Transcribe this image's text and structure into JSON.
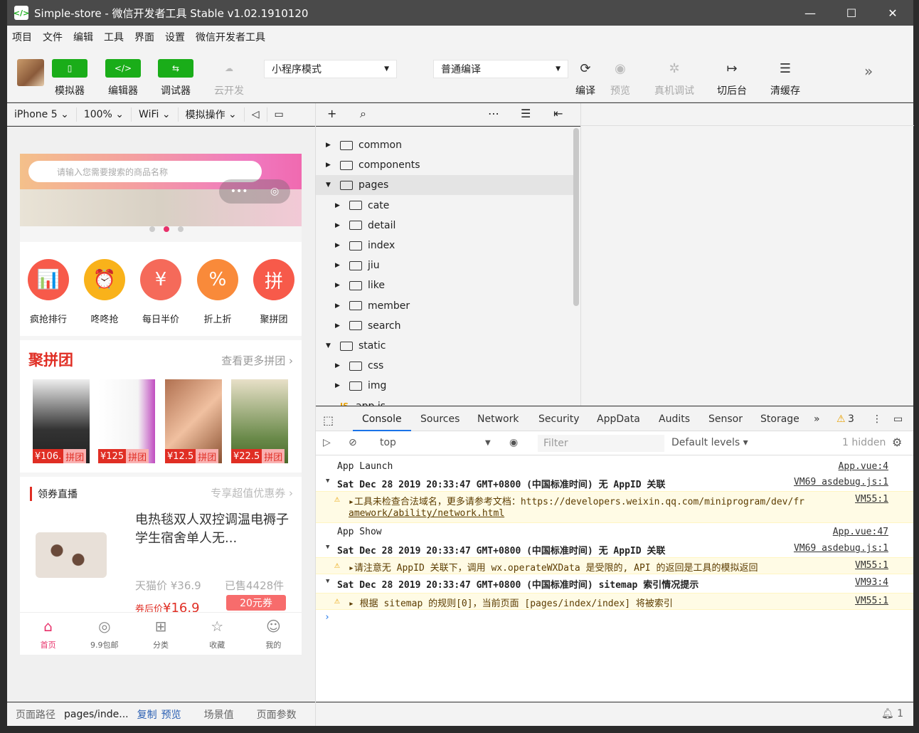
{
  "window": {
    "title": "Simple-store - 微信开发者工具 Stable v1.02.1910120",
    "controls": [
      "—",
      "☐",
      "✕"
    ]
  },
  "menu": [
    "项目",
    "文件",
    "编辑",
    "工具",
    "界面",
    "设置",
    "微信开发者工具"
  ],
  "toolbar": {
    "simulator": "模拟器",
    "editor": "编辑器",
    "debugger": "调试器",
    "cloud": "云开发",
    "mode": "小程序模式",
    "compile_mode": "普通编译",
    "compile": "编译",
    "preview": "预览",
    "remote_debug": "真机调试",
    "background": "切后台",
    "clear_cache": "清缓存"
  },
  "simbar": {
    "device": "iPhone 5",
    "zoom": "100%",
    "network": "WiFi",
    "ops": "模拟操作"
  },
  "phone": {
    "search_placeholder": "请输入您需要搜索的商品名称",
    "categories": [
      "疯抢排行",
      "咚咚抢",
      "每日半价",
      "折上折",
      "聚拼团"
    ],
    "cat_icons": [
      "📊",
      "⏰",
      "¥",
      "%",
      "拼"
    ],
    "cat_colors": [
      "#f75a4a",
      "#f9b21a",
      "#f56a5a",
      "#f98a3a",
      "#f75a4a"
    ],
    "pin_title": "聚拼团",
    "pin_more": "查看更多拼团 ›",
    "pin_items": [
      {
        "price": "¥106.",
        "tag": "拼团"
      },
      {
        "price": "¥125",
        "tag": "拼团"
      },
      {
        "price": "¥12.5",
        "tag": "拼团"
      },
      {
        "price": "¥22.5",
        "tag": "拼团"
      }
    ],
    "coupon_title": "领券直播",
    "coupon_more": "专享超值优惠券 ›",
    "product_name": "电热毯双人双控调温电褥子学生宿舍单人无...",
    "tmall_price": "天猫价 ¥36.9",
    "sold": "已售4428件",
    "after_label": "券后价",
    "after_price": "¥16.9",
    "coupon": "20元券",
    "tabs": [
      "首页",
      "9.9包邮",
      "分类",
      "收藏",
      "我的"
    ]
  },
  "status": {
    "path_label": "页面路径",
    "path": "pages/inde...",
    "copy": "复制",
    "preview": "预览",
    "scene": "场景值",
    "params": "页面参数"
  },
  "tree": [
    {
      "name": "common",
      "level": 0,
      "open": false
    },
    {
      "name": "components",
      "level": 0,
      "open": false
    },
    {
      "name": "pages",
      "level": 0,
      "open": true
    },
    {
      "name": "cate",
      "level": 1,
      "open": false
    },
    {
      "name": "detail",
      "level": 1,
      "open": false
    },
    {
      "name": "index",
      "level": 1,
      "open": false
    },
    {
      "name": "jiu",
      "level": 1,
      "open": false
    },
    {
      "name": "like",
      "level": 1,
      "open": false
    },
    {
      "name": "member",
      "level": 1,
      "open": false
    },
    {
      "name": "search",
      "level": 1,
      "open": false
    },
    {
      "name": "static",
      "level": 0,
      "open": true
    },
    {
      "name": "css",
      "level": 1,
      "open": false
    },
    {
      "name": "img",
      "level": 1,
      "open": false
    },
    {
      "name": "app.js",
      "level": 0,
      "open": false
    }
  ],
  "devtools": {
    "tabs": [
      "Console",
      "Sources",
      "Network",
      "Security",
      "AppData",
      "Audits",
      "Sensor",
      "Storage"
    ],
    "warn_count": "3",
    "context": "top",
    "filter_placeholder": "Filter",
    "levels": "Default levels ▾",
    "hidden": "1 hidden",
    "notif_count": "1"
  },
  "console": [
    {
      "type": "log",
      "msg": "App Launch",
      "src": "App.vue:4"
    },
    {
      "type": "group",
      "msg": "Sat Dec 28 2019 20:33:47 GMT+0800 (中国标准时间) 无 AppID 关联",
      "src": "VM69 asdebug.js:1"
    },
    {
      "type": "warn",
      "msg": "▸工具未检查合法域名，更多请参考文档：https://developers.weixin.qq.com/miniprogram/dev/fr",
      "msg2": "amework/ability/network.html",
      "src": "VM55:1"
    },
    {
      "type": "log",
      "msg": "App Show",
      "src": "App.vue:47"
    },
    {
      "type": "group",
      "msg": "Sat Dec 28 2019 20:33:47 GMT+0800 (中国标准时间) 无 AppID 关联",
      "src": "VM69 asdebug.js:1"
    },
    {
      "type": "warn",
      "msg": "▸请注意无 AppID 关联下，调用 wx.operateWXData 是受限的, API 的返回是工具的模拟返回",
      "src": "VM55:1"
    },
    {
      "type": "group",
      "msg": "Sat Dec 28 2019 20:33:47 GMT+0800 (中国标准时间) sitemap 索引情况提示",
      "src": "VM93:4"
    },
    {
      "type": "warn",
      "msg": "▸ 根据 sitemap 的规则[0]，当前页面 [pages/index/index] 将被索引",
      "src": "VM55:1"
    }
  ]
}
